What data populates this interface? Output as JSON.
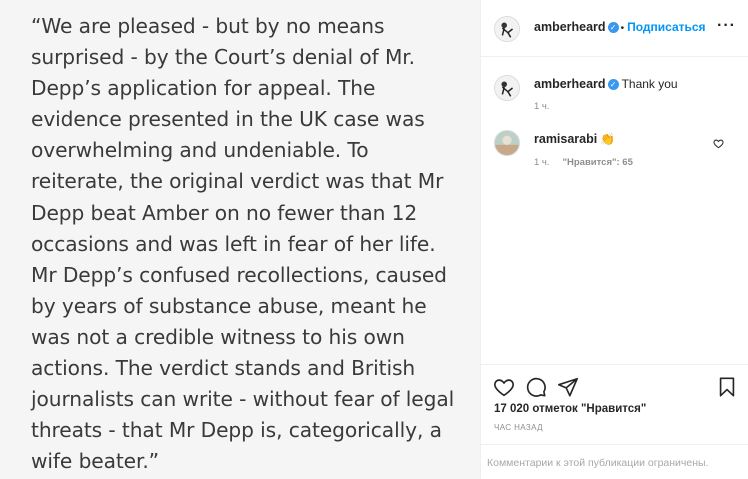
{
  "post": {
    "quote": "“We  are pleased - but by no means\nsurprised - by the Court’s denial of Mr.\nDepp’s application for appeal.  The\nevidence presented in the UK case was\noverwhelming and undeniable. To\nreiterate, the original verdict was that Mr\nDepp beat Amber on no fewer than 12\noccasions and was left in fear of her life.\nMr Depp’s confused recollections, caused\nby years of substance abuse, meant he\nwas not a credible witness to his own\nactions. The verdict stands and British\njournalists can write - without fear of legal\nthreats - that Mr Depp is, categorically, a\nwife beater.”"
  },
  "header": {
    "username": "amberheard",
    "separator": "•",
    "follow_label": "Подписаться",
    "more_icon": "ellipsis-icon"
  },
  "comments": [
    {
      "username": "amberheard",
      "verified": true,
      "text": "Thank you",
      "time": "1 ч.",
      "likes": ""
    },
    {
      "username": "ramisarabi",
      "verified": false,
      "text": "👏",
      "time": "1 ч.",
      "likes": "\"Нравится\": 65"
    }
  ],
  "actions": {
    "icons": [
      "heart-icon",
      "comment-icon",
      "share-icon",
      "bookmark-icon"
    ],
    "likes_text": "17 020 отметок \"Нравится\"",
    "posted_text": "ЧАС НАЗАД",
    "restricted_text": "Комментарии к этой публикации ограничены."
  },
  "colors": {
    "accent": "#0095f6",
    "verified": "#3897f0",
    "secondary_text": "#8e8e8e"
  }
}
